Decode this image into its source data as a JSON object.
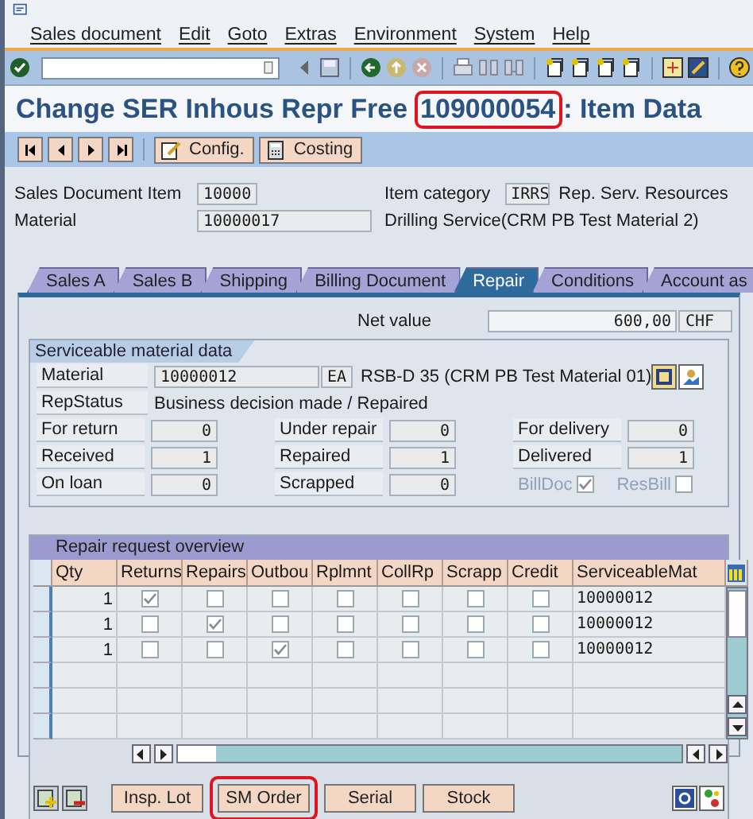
{
  "menu": [
    {
      "label": "Sales document"
    },
    {
      "label": "Edit"
    },
    {
      "label": "Goto"
    },
    {
      "label": "Extras"
    },
    {
      "label": "Environment"
    },
    {
      "label": "System"
    },
    {
      "label": "Help"
    }
  ],
  "title": {
    "prefix": "Change SER Inhous Repr Free",
    "number": "109000054",
    "suffix": ": Item Data",
    "number_highlighted": true
  },
  "app_toolbar": [
    {
      "label": "Config."
    },
    {
      "label": "Costing"
    }
  ],
  "header": {
    "item_label": "Sales Document Item",
    "item": "10000",
    "material_label": "Material",
    "material": "10000017",
    "category_label": "Item category",
    "category": "IRRS",
    "category_text": "Rep. Serv. Resources",
    "material_text": "Drilling Service(CRM PB Test Material 2)"
  },
  "tabs": [
    {
      "label": "Sales A",
      "selected": false
    },
    {
      "label": "Sales B",
      "selected": false
    },
    {
      "label": "Shipping",
      "selected": false
    },
    {
      "label": "Billing Document",
      "selected": false
    },
    {
      "label": "Repair",
      "selected": true
    },
    {
      "label": "Conditions",
      "selected": false
    },
    {
      "label": "Account as",
      "selected": false
    }
  ],
  "repair": {
    "net_value_label": "Net value",
    "net_value": "600,00",
    "currency": "CHF",
    "section_title": "Serviceable material data",
    "material_label": "Material",
    "material": "10000012",
    "unit": "EA",
    "material_text": "RSB-D 35 (CRM PB Test Material 01)",
    "status_label": "RepStatus",
    "status": "Business decision made / Repaired",
    "quantities": [
      {
        "label": "For return",
        "value": "0"
      },
      {
        "label": "Under repair",
        "value": "0"
      },
      {
        "label": "For delivery",
        "value": "0"
      },
      {
        "label": "Received",
        "value": "1"
      },
      {
        "label": "Repaired",
        "value": "1"
      },
      {
        "label": "Delivered",
        "value": "1"
      },
      {
        "label": "On loan",
        "value": "0"
      },
      {
        "label": "Scrapped",
        "value": "0"
      }
    ],
    "flags": [
      {
        "label": "BillDoc",
        "checked": true,
        "disabled": true
      },
      {
        "label": "ResBill",
        "checked": false,
        "disabled": true
      }
    ]
  },
  "overview": {
    "title": "Repair request overview",
    "columns": [
      "Qty",
      "Returns",
      "Repairs",
      "Outbou",
      "Rplmnt",
      "CollRp",
      "Scrapp",
      "Credit",
      "ServiceableMat"
    ],
    "rows": [
      {
        "qty": "1",
        "checks": [
          true,
          false,
          false,
          false,
          false,
          false,
          false
        ],
        "material": "10000012"
      },
      {
        "qty": "1",
        "checks": [
          false,
          true,
          false,
          false,
          false,
          false,
          false
        ],
        "material": "10000012"
      },
      {
        "qty": "1",
        "checks": [
          false,
          false,
          true,
          false,
          false,
          false,
          false
        ],
        "material": "10000012"
      }
    ]
  },
  "buttons": [
    {
      "label": "Insp. Lot",
      "highlighted": false
    },
    {
      "label": "SM Order",
      "highlighted": true
    },
    {
      "label": "Serial",
      "highlighted": false
    },
    {
      "label": "Stock",
      "highlighted": false
    }
  ]
}
